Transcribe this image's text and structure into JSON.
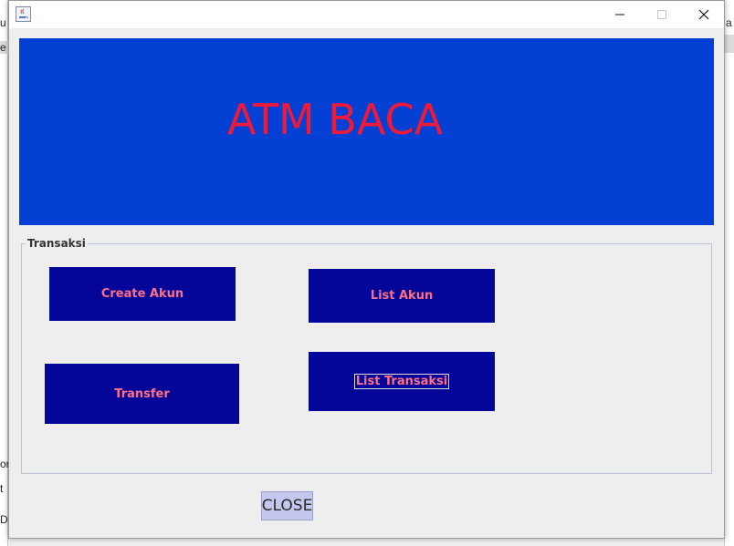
{
  "window": {
    "banner_title": "ATM BACA",
    "group_title": "Transaksi",
    "buttons": {
      "create_akun": "Create Akun",
      "list_akun": "List Akun",
      "transfer": "Transfer",
      "list_transaksi": "List Transaksi"
    },
    "close_label": "CLOSE"
  },
  "background": {
    "fragments_left": [
      "u",
      "e",
      "or",
      "t",
      "Do"
    ],
    "fragments_right": [
      "a"
    ]
  },
  "colors": {
    "banner": "#0340d3",
    "banner_text": "#ee1a3a",
    "button_bg": "#040699",
    "button_text": "#ff6f82",
    "close_bg": "#c5c8ee"
  },
  "icons": {
    "app": "java-icon",
    "minimize": "minimize-icon",
    "maximize": "maximize-icon",
    "close": "close-icon"
  }
}
